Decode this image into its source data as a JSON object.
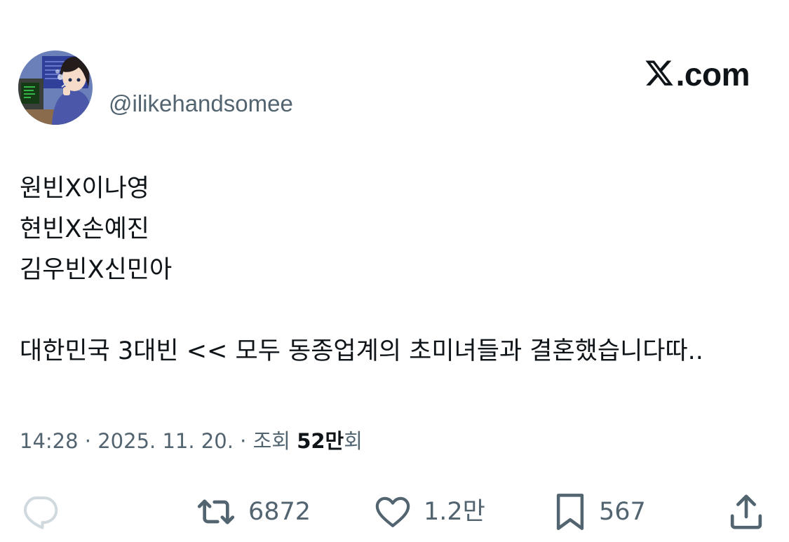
{
  "author": {
    "handle": "@ilikehandsomee",
    "avatar_icon": "anime-girl-at-computer-avatar"
  },
  "site": {
    "logo_icon": "x-logo-icon",
    "name": ".com"
  },
  "tweet": {
    "lines": [
      "원빈X이나영",
      "현빈X손예진",
      "김우빈X신민아",
      "",
      "대한민국 3대빈 << 모두 동종업계의 초미녀들과 결혼했습니다따.."
    ]
  },
  "meta": {
    "time": "14:28",
    "separator": " · ",
    "date": "2025. 11. 20.",
    "views_label": "조회",
    "views_count": "52만",
    "views_suffix": "회"
  },
  "actions": {
    "reply": {
      "icon": "reply-bubble-icon",
      "count": ""
    },
    "retweet": {
      "icon": "retweet-icon",
      "count": "6872"
    },
    "like": {
      "icon": "heart-icon",
      "count": "1.2만"
    },
    "bookmark": {
      "icon": "bookmark-icon",
      "count": "567"
    },
    "share": {
      "icon": "share-icon",
      "count": ""
    }
  },
  "colors": {
    "text_primary": "#0f1419",
    "text_secondary": "#536471",
    "reply_icon_muted": "#cfd9de",
    "background": "#ffffff"
  }
}
